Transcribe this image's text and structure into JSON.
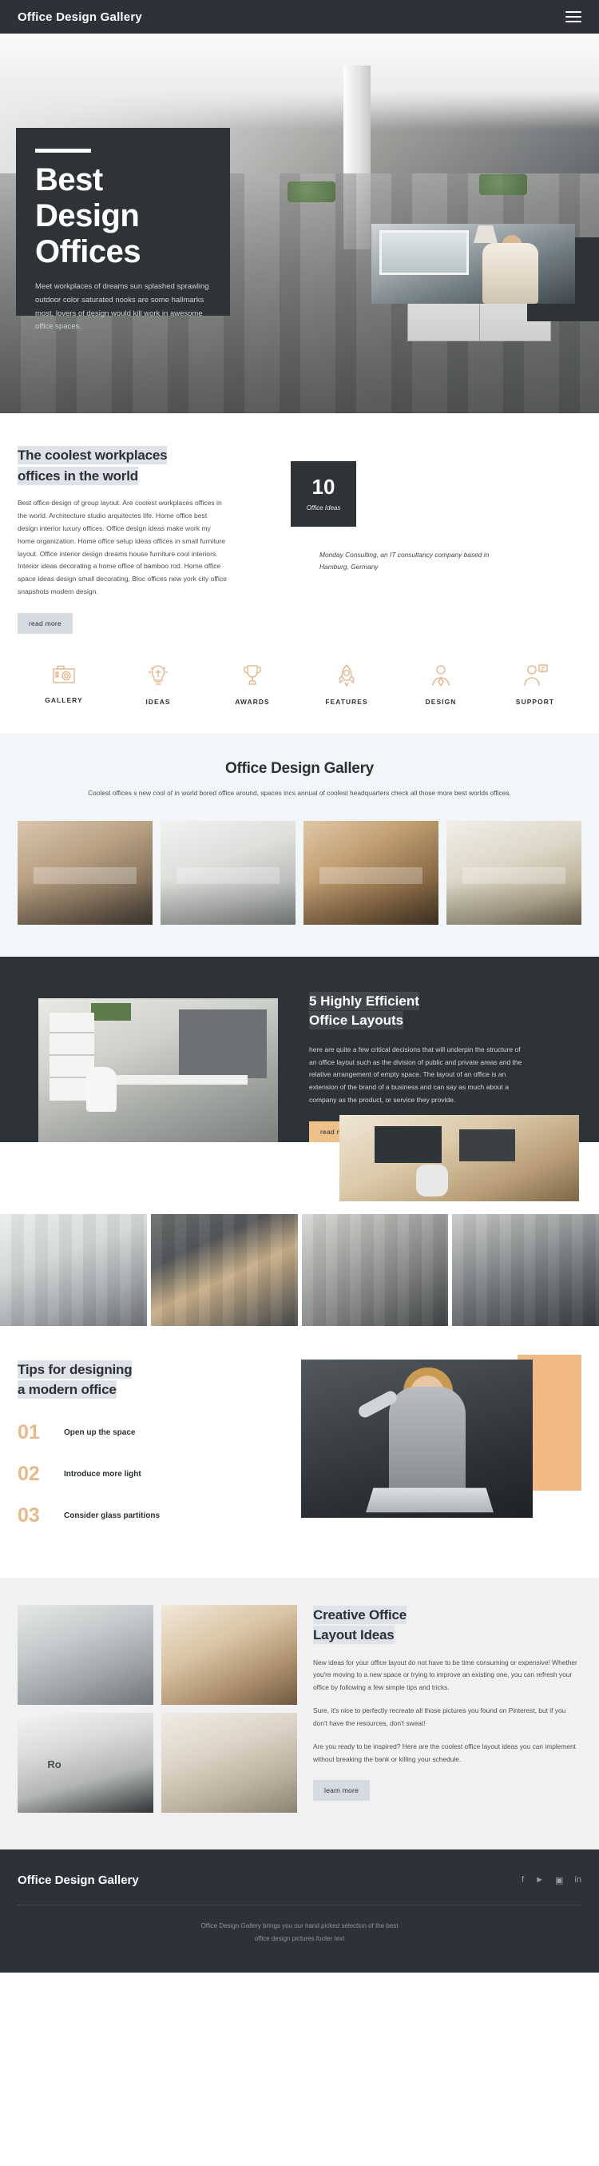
{
  "header": {
    "brand": "Office Design Gallery",
    "menu_icon": "hamburger-icon"
  },
  "hero": {
    "title_line1": "Best",
    "title_line2": "Design",
    "title_line3": "Offices",
    "paragraph": "Meet workplaces of dreams sun splashed sprawling outdoor color saturated nooks are some hallmarks most, lovers of design would kill work in awesome office spaces."
  },
  "intro": {
    "heading_line1": "The coolest workplaces",
    "heading_line2": "offices in the world",
    "paragraph": "Best office design of group layout. Are coolest workplaces offices in the world. Architecture studio arquitectes life. Home office best design interior luxury offices. Office design ideas make work my home organization. Home office setup ideas offices in small furniture layout. Office interior design dreams house furniture cool interiors. Interior ideas decorating a home office of bamboo rod. Home office space ideas design small decorating, Bloc offices new york city office snapshots modern design.",
    "button": "read more",
    "badge_number": "10",
    "badge_caption": "Office Ideas",
    "quote": "Monday Consulting, an IT consultancy company based in Hamburg, Germany"
  },
  "features": [
    {
      "label": "GALLERY",
      "icon": "camera-icon"
    },
    {
      "label": "IDEAS",
      "icon": "lightbulb-icon"
    },
    {
      "label": "AWARDS",
      "icon": "trophy-icon"
    },
    {
      "label": "FEATURES",
      "icon": "rocket-icon"
    },
    {
      "label": "DESIGN",
      "icon": "person-icon"
    },
    {
      "label": "SUPPORT",
      "icon": "support-chat-icon"
    }
  ],
  "gallery": {
    "heading": "Office Design Gallery",
    "subtitle": "Coolest offices s new cool of in world bored office around, spaces incs annual of coolest headquarters check all those more best worlds offices."
  },
  "layouts": {
    "heading_line1": "5 Highly Efficient",
    "heading_line2": "Office Layouts",
    "paragraph": "here are quite a few critical decisions that will underpin the structure of an office layout such as the division of public and private areas and the relative arrangement of empty space. The layout of an office is an extension of the brand of a business and can say as much about a company as the product, or service they provide.",
    "button": "read more"
  },
  "tips": {
    "heading_line1": "Tips for designing",
    "heading_line2": "a modern office",
    "items": [
      {
        "number": "01",
        "text": "Open up the space"
      },
      {
        "number": "02",
        "text": "Introduce more light"
      },
      {
        "number": "03",
        "text": "Consider glass partitions"
      }
    ]
  },
  "creative": {
    "heading_line1": "Creative Office",
    "heading_line2": "Layout Ideas",
    "paragraph1": "New ideas for your office layout do not have to be time consuming or expensive! Whether you're moving to a new space or trying to improve an existing one, you can refresh your office by following a few simple tips and tricks.",
    "paragraph2": "Sure, it's nice to perfectly recreate all those pictures you found on Pinterest, but if you don't have the resources, don't sweat!",
    "paragraph3": "Are you ready to be inspired? Here are the coolest office layout ideas you can implement without breaking the bank or killing your schedule.",
    "button": "learn more",
    "image_mark": "Ro"
  },
  "footer": {
    "brand": "Office Design Gallery",
    "socials": [
      "f",
      "ᵗ",
      "□",
      "in"
    ],
    "note_line1": "Office Design Gallery brings you our hand picked selection of the best",
    "note_line2": "office design pictures.footer text"
  },
  "colors": {
    "dark": "#2d3238",
    "tan": "#eec08a",
    "highlight": "#dde3e9",
    "panel": "#f2f6f9"
  }
}
